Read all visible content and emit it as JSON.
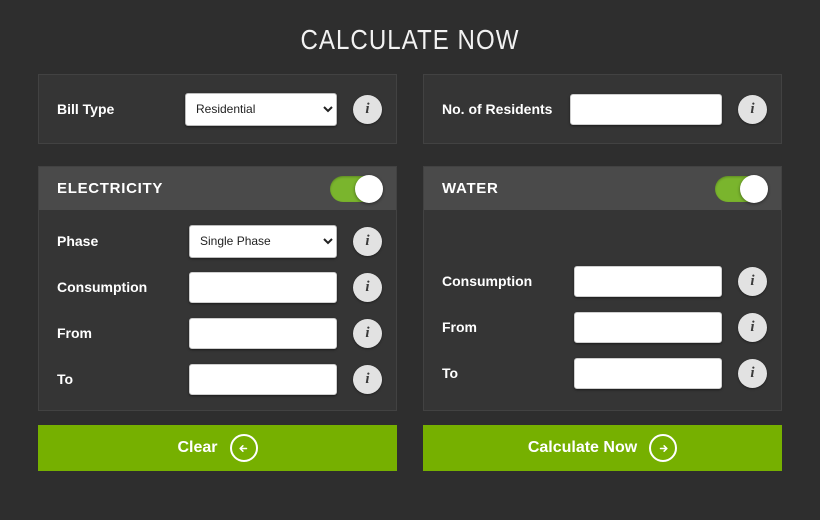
{
  "header": {
    "title": "CALCULATE NOW"
  },
  "colors": {
    "page_background": "#2e2e2e",
    "panel_background": "#353535",
    "section_header_background": "#4a4a4a",
    "accent_green": "#76b000",
    "toggle_green": "#7ab52d",
    "text_white": "#ffffff"
  },
  "left_column": {
    "bill_type": {
      "label": "Bill Type",
      "selected": "Residential",
      "options": [
        "Residential"
      ],
      "info_icon": "info-icon"
    },
    "electricity": {
      "title": "ELECTRICITY",
      "toggle_state": "on",
      "fields": [
        {
          "label": "Phase",
          "type": "select",
          "value": "Single Phase",
          "options": [
            "Single Phase"
          ],
          "placeholder": ""
        },
        {
          "label": "Consumption",
          "type": "text",
          "value": "",
          "placeholder": ""
        },
        {
          "label": "From",
          "type": "text",
          "value": "",
          "placeholder": ""
        },
        {
          "label": "To",
          "type": "text",
          "value": "",
          "placeholder": ""
        }
      ]
    },
    "action": {
      "label": "Clear",
      "icon": "arrow-left-circle-icon"
    }
  },
  "right_column": {
    "residents": {
      "label": "No. of Residents",
      "value": "",
      "placeholder": "",
      "info_icon": "info-icon"
    },
    "water": {
      "title": "WATER",
      "toggle_state": "on",
      "fields": [
        {
          "label": "Consumption",
          "type": "text",
          "value": "",
          "placeholder": ""
        },
        {
          "label": "From",
          "type": "text",
          "value": "",
          "placeholder": ""
        },
        {
          "label": "To",
          "type": "text",
          "value": "",
          "placeholder": ""
        }
      ]
    },
    "action": {
      "label": "Calculate Now",
      "icon": "arrow-right-circle-icon"
    }
  },
  "info_glyph": "i"
}
